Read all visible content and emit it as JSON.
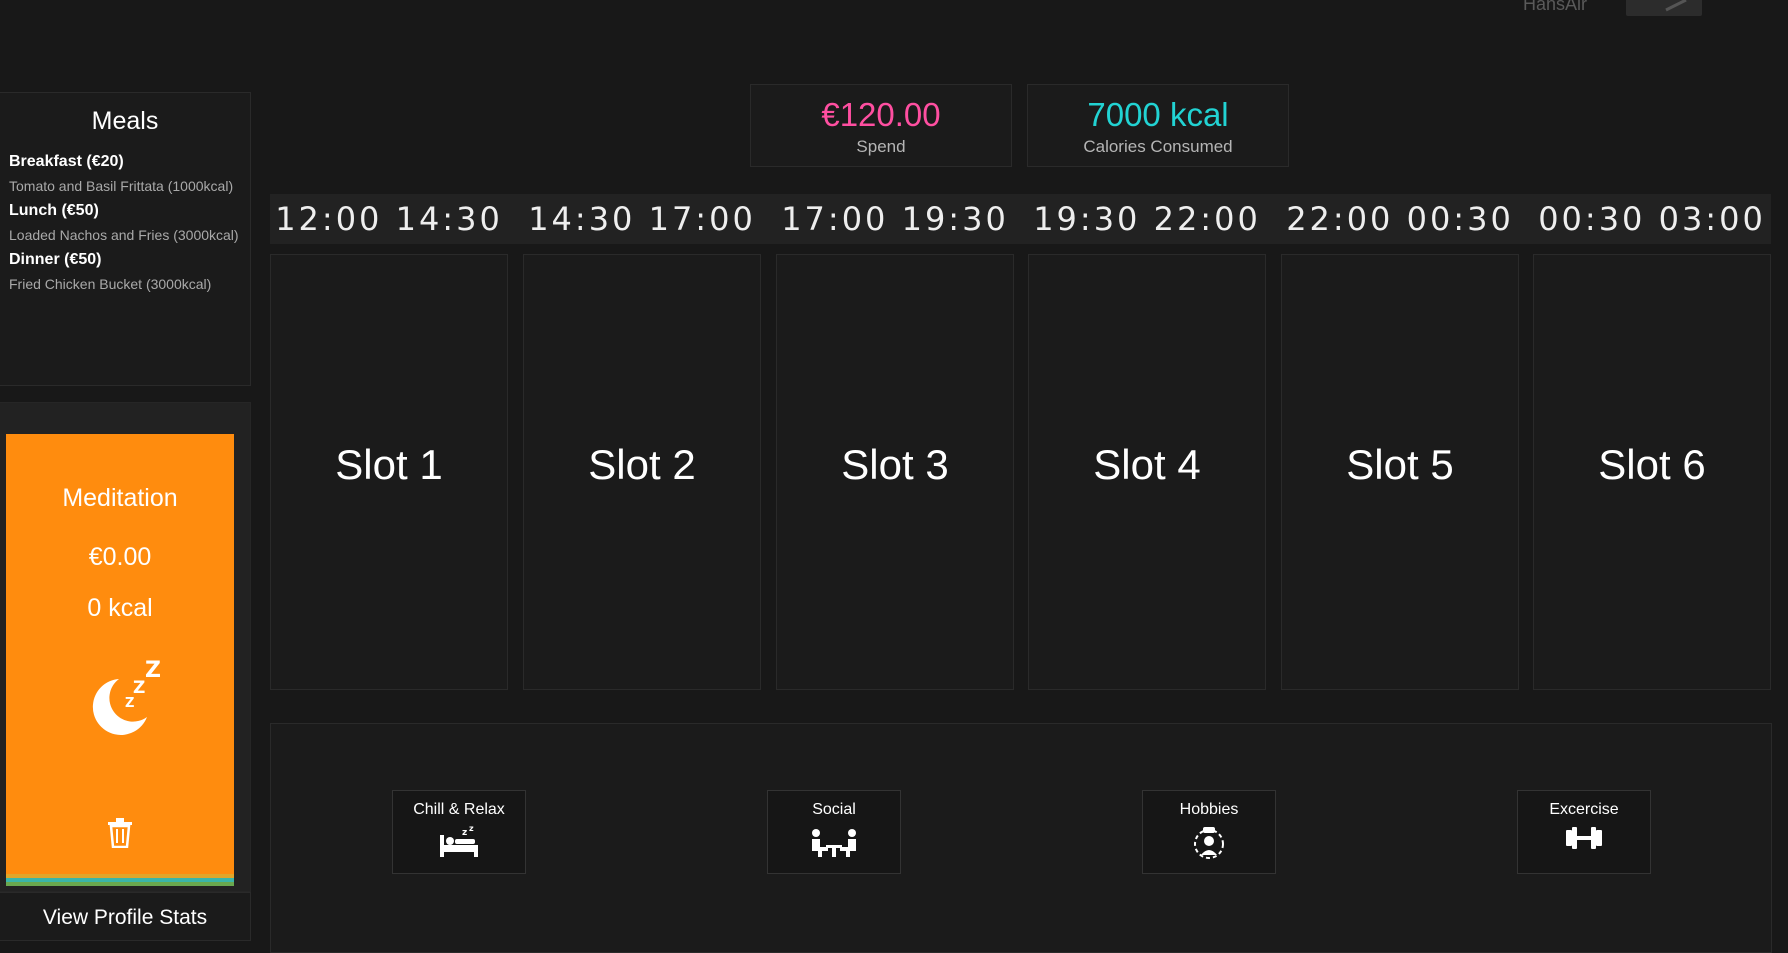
{
  "topbar": {
    "username": "HansAir"
  },
  "meals": {
    "title": "Meals",
    "items": [
      {
        "name": "Breakfast (€20)",
        "description": "Tomato and Basil Frittata (1000kcal)"
      },
      {
        "name": "Lunch (€50)",
        "description": "Loaded Nachos and Fries (3000kcal)"
      },
      {
        "name": "Dinner (€50)",
        "description": "Fried Chicken Bucket (3000kcal)"
      }
    ]
  },
  "activity": {
    "title": "Meditation",
    "price": "€0.00",
    "kcal": "0 kcal",
    "icon": "sleeping-moon-icon",
    "color": "#ff8c0e"
  },
  "stripes": [
    "#e0a62a",
    "#3bb5a8",
    "#6aa84f"
  ],
  "profile": {
    "button_label": "View Profile Stats"
  },
  "stats": {
    "spend": {
      "value": "€120.00",
      "label": "Spend",
      "color": "#ff4fa1"
    },
    "calories": {
      "value": "7000 kcal",
      "label": "Calories Consumed",
      "color": "#22d3d3"
    }
  },
  "times": [
    "12:00 14:30",
    "14:30 17:00",
    "17:00 19:30",
    "19:30 22:00",
    "22:00 00:30",
    "00:30 03:00"
  ],
  "slots": [
    "Slot 1",
    "Slot 2",
    "Slot 3",
    "Slot 4",
    "Slot 5",
    "Slot 6"
  ],
  "categories": [
    {
      "label": "Chill & Relax",
      "icon": "bed-icon"
    },
    {
      "label": "Social",
      "icon": "social-icon"
    },
    {
      "label": "Hobbies",
      "icon": "hobbies-icon"
    },
    {
      "label": "Excercise",
      "icon": "dumbbell-icon"
    }
  ]
}
